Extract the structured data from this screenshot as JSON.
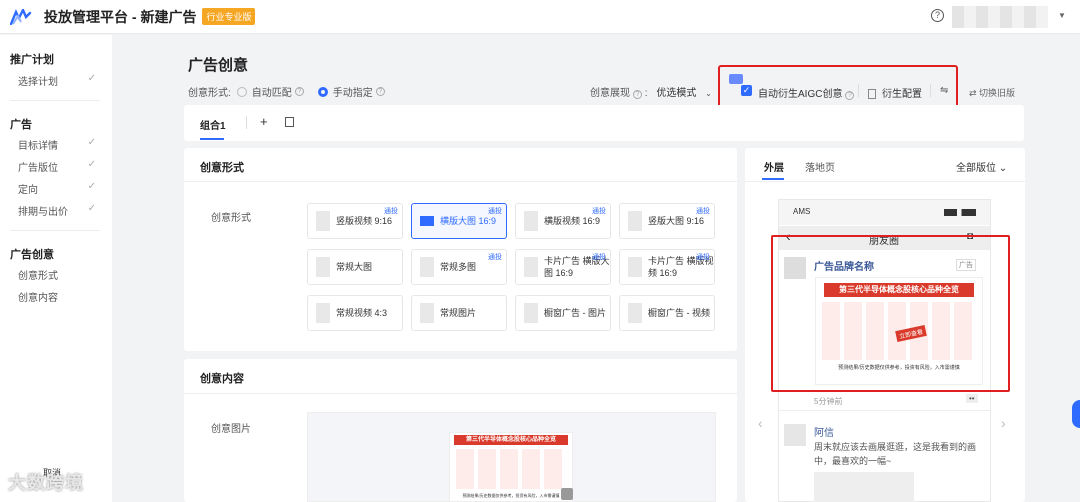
{
  "header": {
    "title": "投放管理平台 - 新建广告",
    "badge": "行业专业版",
    "help": "?"
  },
  "sidebar": {
    "groups": [
      {
        "title": "推广计划",
        "items": [
          {
            "label": "选择计划",
            "done": true
          }
        ]
      },
      {
        "title": "广告",
        "items": [
          {
            "label": "目标详情",
            "done": true
          },
          {
            "label": "广告版位",
            "done": true
          },
          {
            "label": "定向",
            "done": true
          },
          {
            "label": "排期与出价",
            "done": true
          }
        ]
      },
      {
        "title": "广告创意",
        "items": [
          {
            "label": "创意形式",
            "done": false
          },
          {
            "label": "创意内容",
            "done": false
          }
        ]
      }
    ],
    "cancel": "取消"
  },
  "page": {
    "title": "广告创意"
  },
  "form": {
    "label": "创意形式:",
    "opt_auto": "自动匹配",
    "opt_manual": "手动指定"
  },
  "display": {
    "label": "创意展现",
    "mode": "优选模式"
  },
  "aigc": {
    "check": "✓",
    "label": "自动衍生AIGC创意",
    "derive": "衍生配置",
    "filter": "⇋",
    "old": "⇄ 切换旧版"
  },
  "combo": {
    "tab": "组合1",
    "add": "+"
  },
  "creative_form": {
    "title": "创意形式",
    "field": "创意形式",
    "cards": [
      {
        "label": "竖版视频 9:16",
        "tag": "通投",
        "selected": false
      },
      {
        "label": "横版大图 16:9",
        "tag": "通投",
        "selected": true
      },
      {
        "label": "横版视频 16:9",
        "tag": "通投",
        "selected": false
      },
      {
        "label": "竖版大图 9:16",
        "tag": "通投",
        "selected": false
      },
      {
        "label": "常规大图",
        "tag": "",
        "selected": false
      },
      {
        "label": "常规多图",
        "tag": "通投",
        "selected": false
      },
      {
        "label": "卡片广告 横版大图 16:9",
        "tag": "通投",
        "selected": false
      },
      {
        "label": "卡片广告 横版视频 16:9",
        "tag": "通投",
        "selected": false
      },
      {
        "label": "常规视频 4:3",
        "tag": "",
        "selected": false
      },
      {
        "label": "常规图片",
        "tag": "",
        "selected": false
      },
      {
        "label": "橱窗广告 - 图片",
        "tag": "",
        "selected": false
      },
      {
        "label": "橱窗广告 - 视频",
        "tag": "",
        "selected": false
      }
    ]
  },
  "creative_content": {
    "title": "创意内容",
    "field": "创意图片"
  },
  "infographic": {
    "headline": "第三代半导体概念股核心品种全览",
    "stamp": "立即查看",
    "footer": "预测结果/历史数据仅供参考，投资有风险，入市需谨慎"
  },
  "right": {
    "tab_outer": "外层",
    "tab_landing": "落地页",
    "placement": "全部版位"
  },
  "phone": {
    "carrier": "AMS",
    "moments": "朋友圈",
    "back": "‹",
    "camera": "◘",
    "brand": "广告品牌名称",
    "ad_tag": "广告",
    "time": "5分钟前",
    "more": "••",
    "comment_name": "阿信",
    "comment_text": "周末就应该去画展逛逛，这是我看到的画中，最喜欢的一幅~"
  },
  "watermark": "大数跨境",
  "colors": {
    "accent": "#2f6bff",
    "highlight": "#e02020",
    "badge": "#f5a623"
  }
}
